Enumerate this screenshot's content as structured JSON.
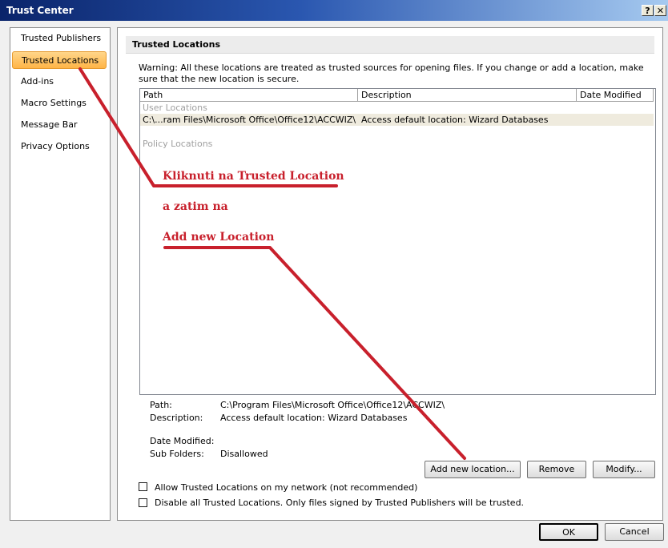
{
  "window": {
    "title": "Trust Center",
    "help_glyph": "?",
    "close_glyph": "✕"
  },
  "sidebar": {
    "items": [
      {
        "label": "Trusted Publishers"
      },
      {
        "label": "Trusted Locations",
        "active": true
      },
      {
        "label": "Add-ins"
      },
      {
        "label": "Macro Settings"
      },
      {
        "label": "Message Bar"
      },
      {
        "label": "Privacy Options"
      }
    ]
  },
  "main": {
    "section_title": "Trusted Locations",
    "warning": "Warning: All these locations are treated as trusted sources for opening files.  If you change or add a location, make sure that the new location is secure.",
    "columns": [
      "Path",
      "Description",
      "Date Modified"
    ],
    "user_locations_label": "User Locations",
    "policy_locations_label": "Policy Locations",
    "rows": [
      {
        "path": "C:\\...ram Files\\Microsoft Office\\Office12\\ACCWIZ\\",
        "description": "Access default location: Wizard Databases",
        "date_modified": ""
      }
    ],
    "details": {
      "path_label": "Path:",
      "path_value": "C:\\Program Files\\Microsoft Office\\Office12\\ACCWIZ\\",
      "description_label": "Description:",
      "description_value": "Access default location: Wizard Databases",
      "date_modified_label": "Date Modified:",
      "date_modified_value": "",
      "sub_folders_label": "Sub Folders:",
      "sub_folders_value": "Disallowed"
    },
    "buttons": {
      "add": "Add new location...",
      "remove": "Remove",
      "modify": "Modify..."
    },
    "checkboxes": [
      {
        "label": "Allow Trusted Locations on my network (not recommended)",
        "checked": false
      },
      {
        "label": "Disable all Trusted Locations. Only files signed by Trusted Publishers will be trusted.",
        "checked": false
      }
    ]
  },
  "footer": {
    "ok": "OK",
    "cancel": "Cancel"
  },
  "annotations": {
    "line1": "Kliknuti na Trusted Location",
    "line2": "a zatim na",
    "line3": "Add new Location",
    "color": "#c8202c"
  },
  "colors": {
    "title_start": "#0a246a",
    "active_item": "#ffb547",
    "selected_row": "#efebde"
  }
}
